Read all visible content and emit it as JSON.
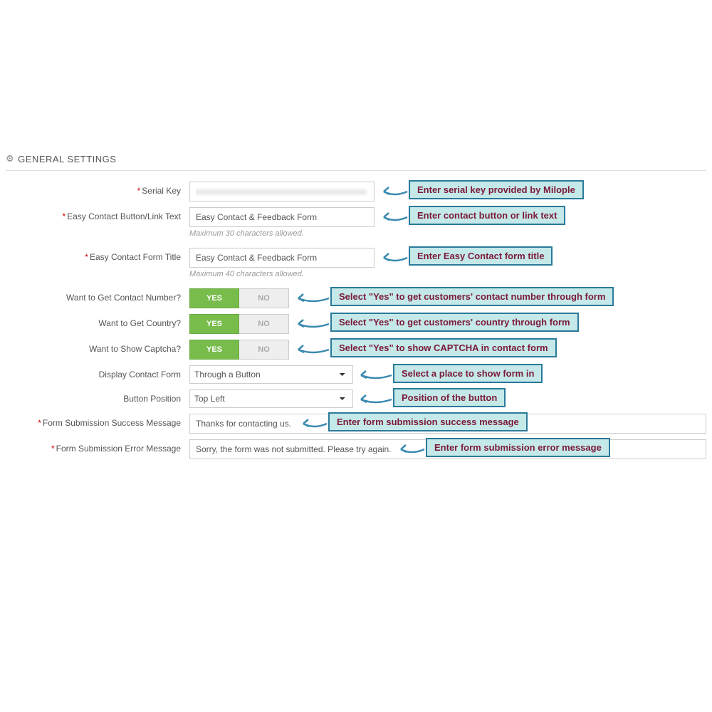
{
  "section_title": "GENERAL SETTINGS",
  "fields": {
    "serial_key": {
      "label": "Serial Key",
      "value": "xxxxxxxxxxxxxxxxxxxxxxxxxxxxxxxxxxxxxxxx"
    },
    "button_text": {
      "label": "Easy Contact Button/Link Text",
      "value": "Easy Contact & Feedback Form",
      "help": "Maximum 30 characters allowed."
    },
    "form_title": {
      "label": "Easy Contact Form Title",
      "value": "Easy Contact & Feedback Form",
      "help": "Maximum 40 characters allowed."
    },
    "contact_number": {
      "label": "Want to Get Contact Number?",
      "yes": "YES",
      "no": "NO"
    },
    "country": {
      "label": "Want to Get Country?",
      "yes": "YES",
      "no": "NO"
    },
    "captcha": {
      "label": "Want to Show Captcha?",
      "yes": "YES",
      "no": "NO"
    },
    "display_form": {
      "label": "Display Contact Form",
      "value": "Through a Button"
    },
    "button_position": {
      "label": "Button Position",
      "value": "Top Left"
    },
    "success_msg": {
      "label": "Form Submission Success Message",
      "value": "Thanks for contacting us."
    },
    "error_msg": {
      "label": "Form Submission Error Message",
      "value": "Sorry, the form was not submitted. Please try again."
    }
  },
  "callouts": {
    "serial_key": "Enter serial key provided by Milople",
    "button_text": "Enter contact button or link text",
    "form_title": "Enter Easy Contact form title",
    "contact_number": "Select \"Yes\" to get customers' contact number through form",
    "country": "Select \"Yes\" to get customers' country through form",
    "captcha": "Select \"Yes\" to show CAPTCHA in contact form",
    "display_form": "Select a place to show form in",
    "button_position": "Position of the button",
    "success_msg": "Enter form submission success message",
    "error_msg": "Enter form submission error message"
  }
}
